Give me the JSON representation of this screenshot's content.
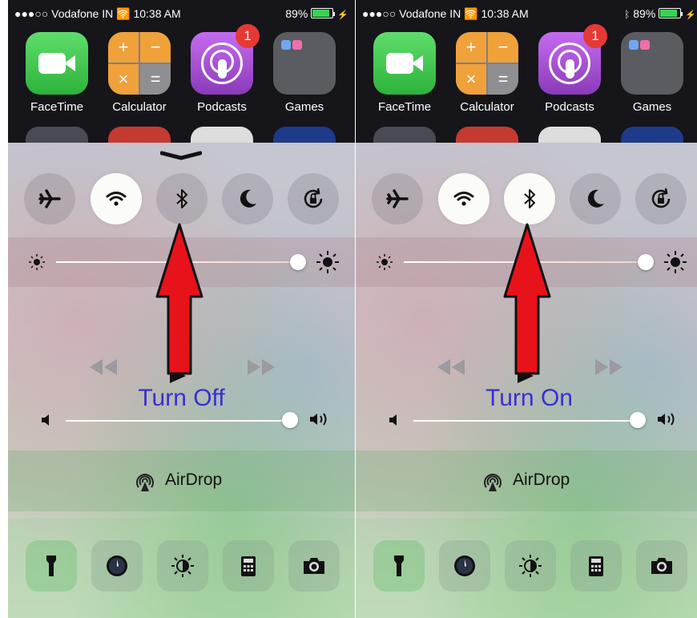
{
  "left": {
    "status": {
      "carrier": "●●●○○ Vodafone IN",
      "time": "10:38 AM",
      "battery": "89%"
    },
    "apps": [
      {
        "label": "FaceTime"
      },
      {
        "label": "Calculator"
      },
      {
        "label": "Podcasts",
        "badge": "1"
      },
      {
        "label": "Games"
      }
    ],
    "caption": "Turn Off",
    "airdrop": "AirDrop"
  },
  "right": {
    "status": {
      "carrier": "●●●○○ Vodafone IN",
      "time": "10:38 AM",
      "battery": "89%"
    },
    "apps": [
      {
        "label": "FaceTime"
      },
      {
        "label": "Calculator"
      },
      {
        "label": "Podcasts",
        "badge": "1"
      },
      {
        "label": "Games"
      }
    ],
    "caption": "Turn On",
    "airdrop": "AirDrop"
  },
  "toggles_left": {
    "airplane": false,
    "wifi": true,
    "bluetooth": false,
    "do_not_disturb": false,
    "rotation_lock": false
  },
  "toggles_right": {
    "airplane": false,
    "wifi": true,
    "bluetooth": true,
    "do_not_disturb": false,
    "rotation_lock": false
  },
  "levels": {
    "brightness": 0.97,
    "volume": 0.97
  },
  "icons": [
    "airplane-icon",
    "wifi-icon",
    "bluetooth-icon",
    "moon-icon",
    "rotation-lock-icon",
    "flashlight-icon",
    "timer-icon",
    "night-shift-icon",
    "calculator-icon",
    "camera-icon",
    "airdrop-icon"
  ],
  "colors": {
    "caption": "#3a2fd1",
    "arrow": "#e8121a",
    "badge": "#e53935"
  }
}
